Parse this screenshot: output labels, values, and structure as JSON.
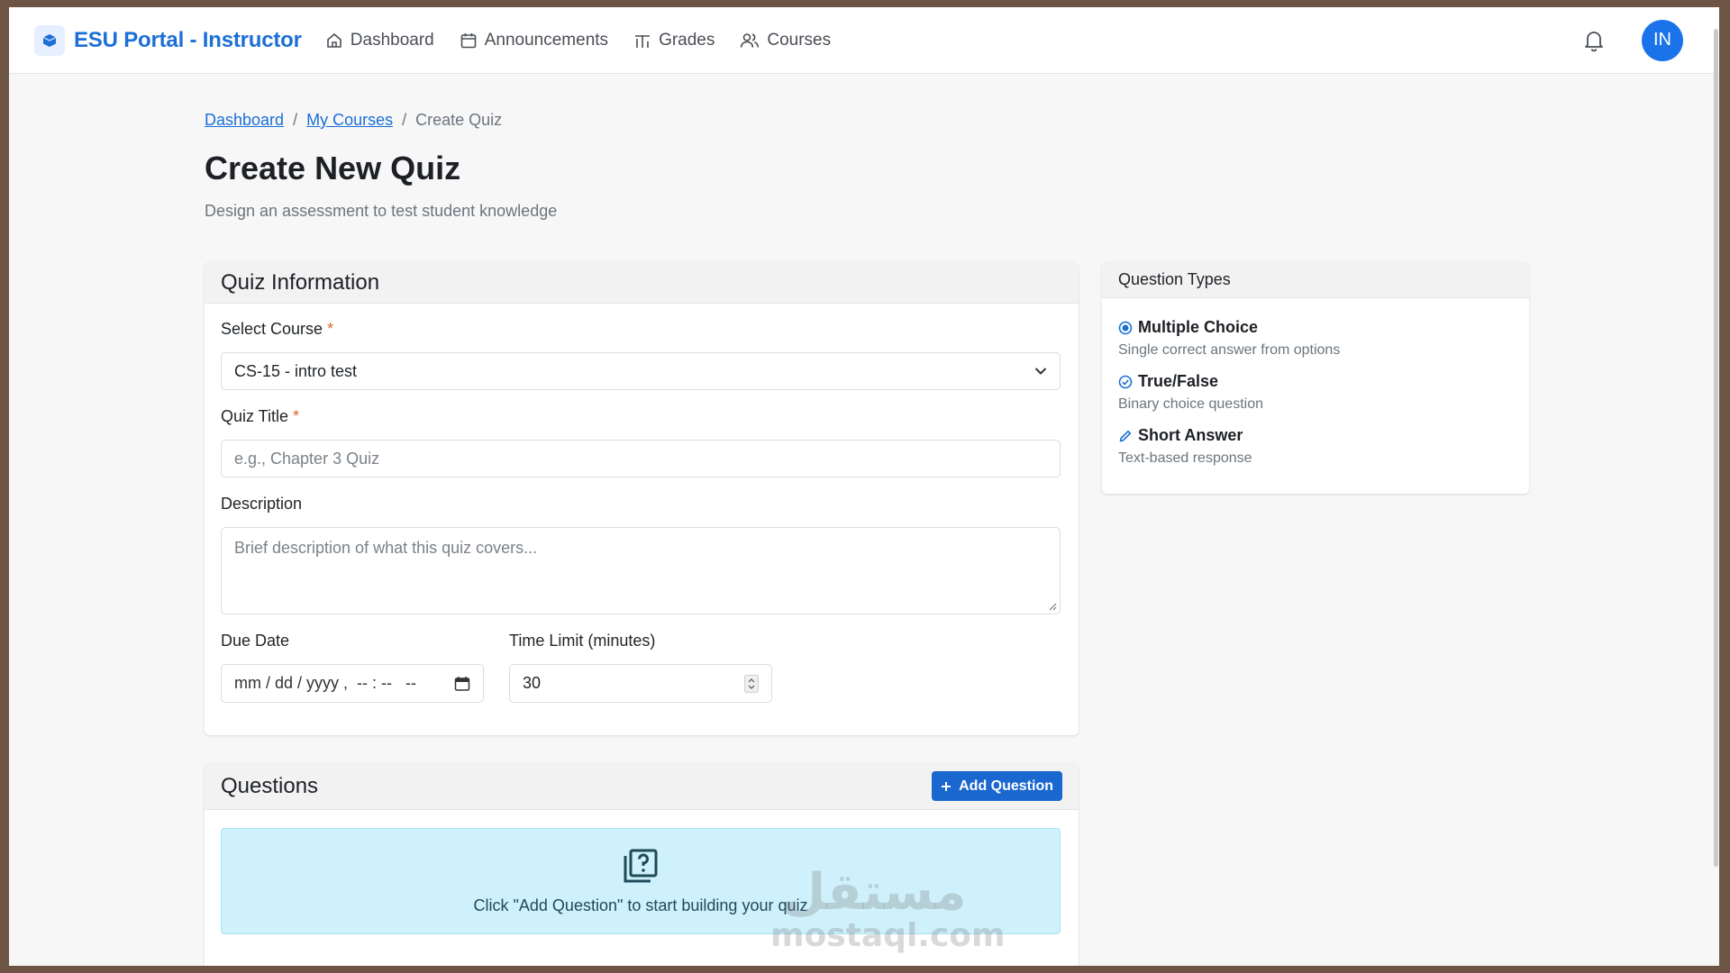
{
  "navbar": {
    "brand": "ESU Portal - Instructor",
    "links": [
      {
        "label": "Dashboard",
        "icon": "home-icon"
      },
      {
        "label": "Announcements",
        "icon": "calendar-icon"
      },
      {
        "label": "Grades",
        "icon": "chart-icon"
      },
      {
        "label": "Courses",
        "icon": "users-icon"
      }
    ],
    "avatar_initials": "IN"
  },
  "breadcrumb": {
    "items": [
      "Dashboard",
      "My Courses"
    ],
    "current": "Create Quiz",
    "separator": "/"
  },
  "page": {
    "title": "Create New Quiz",
    "subtitle": "Design an assessment to test student knowledge"
  },
  "quiz_info": {
    "header": "Quiz Information",
    "course_label": "Select Course",
    "course_value": "CS-15 - intro test",
    "title_label": "Quiz Title",
    "title_placeholder": "e.g., Chapter 3 Quiz",
    "description_label": "Description",
    "description_placeholder": "Brief description of what this quiz covers...",
    "due_label": "Due Date",
    "due_placeholder": "mm / dd / yyyy ,  -- : --   --",
    "time_label": "Time Limit (minutes)",
    "time_value": "30",
    "required_mark": "*"
  },
  "question_types": {
    "header": "Question Types",
    "items": [
      {
        "title": "Multiple Choice",
        "desc": "Single correct answer from options",
        "icon": "radio-icon"
      },
      {
        "title": "True/False",
        "desc": "Binary choice question",
        "icon": "check-circle-icon"
      },
      {
        "title": "Short Answer",
        "desc": "Text-based response",
        "icon": "pencil-icon"
      }
    ]
  },
  "questions": {
    "header": "Questions",
    "add_button": "Add Question",
    "empty_text": "Click \"Add Question\" to start building your quiz"
  },
  "watermark": {
    "arabic": "مستقل",
    "latin": "mostaql.com"
  },
  "colors": {
    "primary": "#1c6fd6",
    "button": "#1967cf",
    "info_bg": "#cff1fb",
    "required": "#dc6a2c"
  }
}
